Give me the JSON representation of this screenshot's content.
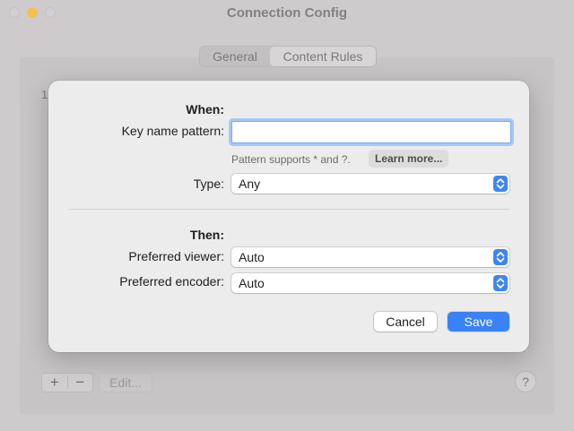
{
  "window": {
    "title": "Connection Config",
    "tabs": [
      {
        "label": "General",
        "selected": false
      },
      {
        "label": "Content Rules",
        "selected": true
      }
    ],
    "panel_stub_text": "1",
    "add_label": "+",
    "remove_label": "−",
    "edit_label": "Edit...",
    "help_label": "?"
  },
  "sheet": {
    "when_heading": "When:",
    "key_name_label": "Key name pattern:",
    "key_name_value": "",
    "key_name_placeholder": "",
    "hint_text": "Pattern supports * and ?.",
    "learn_more_label": "Learn more...",
    "type_label": "Type:",
    "type_value": "Any",
    "then_heading": "Then:",
    "viewer_label": "Preferred viewer:",
    "viewer_value": "Auto",
    "encoder_label": "Preferred encoder:",
    "encoder_value": "Auto",
    "cancel_label": "Cancel",
    "save_label": "Save"
  },
  "colors": {
    "accent": "#3a82f7",
    "focus_ring": "#a9c7f7",
    "minimize_light": "#f5be4f"
  },
  "icons": [
    "stepper-arrows-icon"
  ]
}
